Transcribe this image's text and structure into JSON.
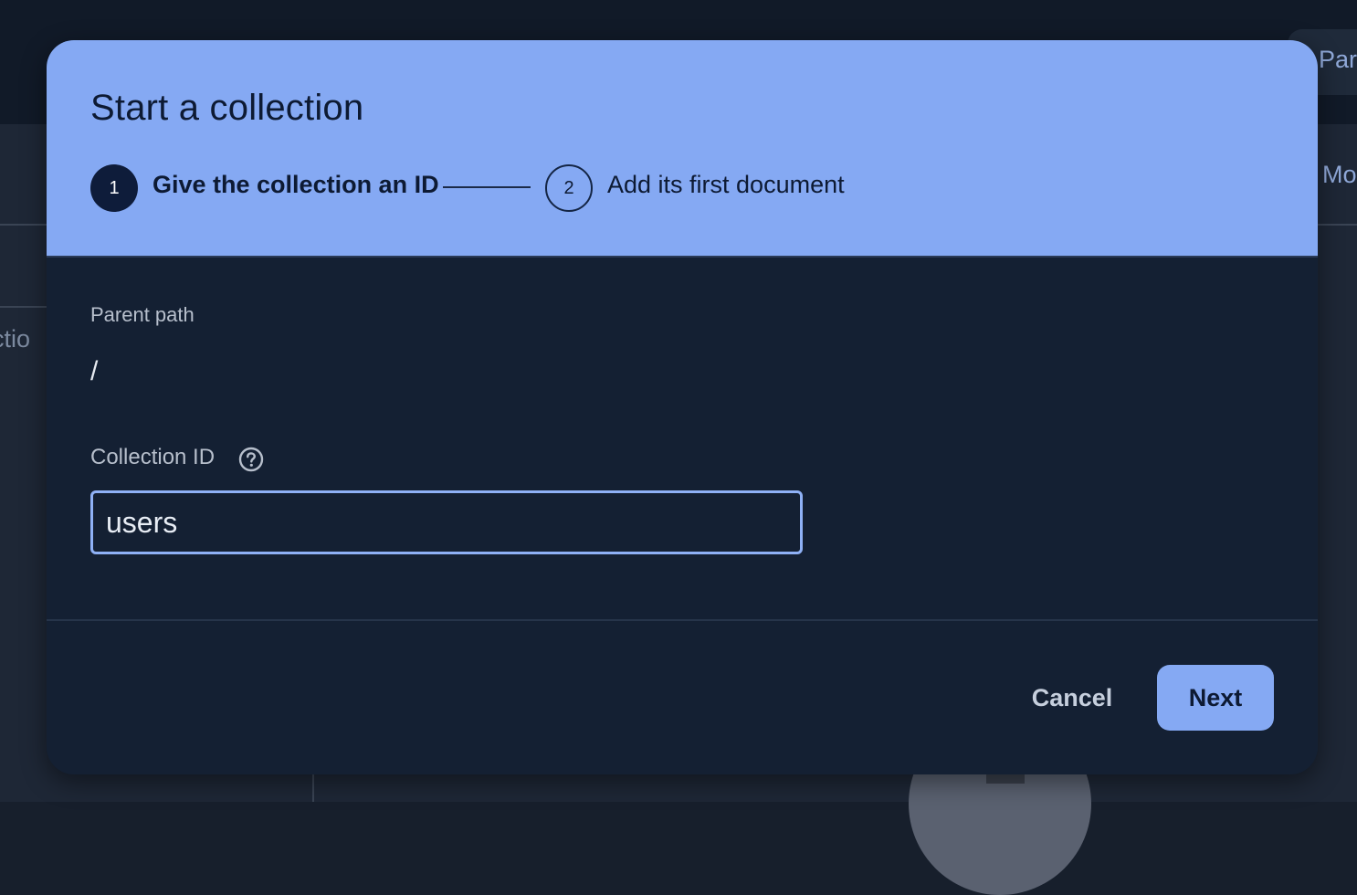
{
  "background": {
    "top_chip_label": "Par",
    "tab_label": "Mo",
    "left_label": "ectio"
  },
  "dialog": {
    "title": "Start a collection",
    "steps": [
      {
        "number": "1",
        "label": "Give the collection an ID",
        "state": "active"
      },
      {
        "number": "2",
        "label": "Add its first document",
        "state": "inactive"
      }
    ],
    "parent_path": {
      "label": "Parent path",
      "value": "/"
    },
    "collection_id": {
      "label": "Collection ID",
      "value": "users",
      "help_icon": "help-circle-icon"
    },
    "actions": {
      "cancel_label": "Cancel",
      "next_label": "Next"
    }
  },
  "colors": {
    "header_bg": "#85a9f3",
    "body_bg": "#142033",
    "accent": "#85a9f3",
    "title_text": "#0d1a33",
    "input_border": "#8fb1f6"
  }
}
